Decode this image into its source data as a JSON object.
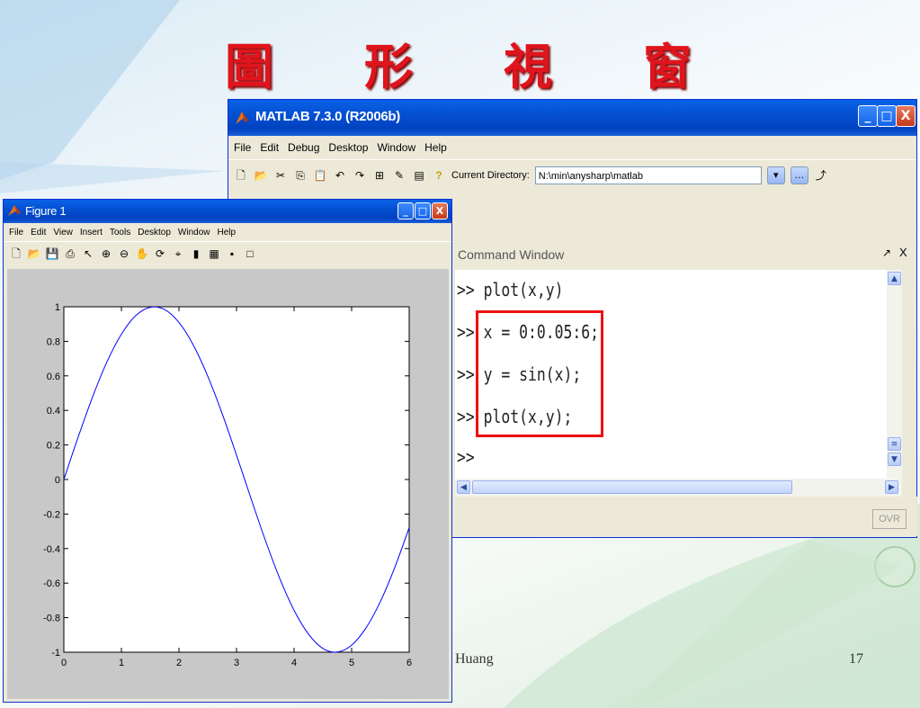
{
  "slide": {
    "title_chars": [
      "圖",
      "形",
      "視",
      "窗"
    ],
    "footer_text": "Huang",
    "page_number": "17"
  },
  "matlab": {
    "title": "MATLAB  7.3.0 (R2006b)",
    "menu": [
      "File",
      "Edit",
      "Debug",
      "Desktop",
      "Window",
      "Help"
    ],
    "current_directory_label": "Current Directory:",
    "current_directory_value": "N:\\min\\anysharp\\matlab",
    "command_window_title": "Command Window",
    "command_lines": [
      ">> plot(x,y)",
      ">> x = 0:0.05:6;",
      ">> y = sin(x);",
      ">> plot(x,y);",
      ">>"
    ],
    "status_ovr": "OVR",
    "window_buttons": {
      "minimize": "_",
      "maximize": "□",
      "close": "X"
    }
  },
  "figure": {
    "title": "Figure 1",
    "menu": [
      "File",
      "Edit",
      "View",
      "Insert",
      "Tools",
      "Desktop",
      "Window",
      "Help"
    ],
    "window_buttons": {
      "minimize": "_",
      "maximize": "□",
      "close": "X"
    }
  },
  "chart_data": {
    "type": "line",
    "title": "",
    "xlabel": "",
    "ylabel": "",
    "xlim": [
      0,
      6
    ],
    "ylim": [
      -1,
      1
    ],
    "xticks": [
      0,
      1,
      2,
      3,
      4,
      5,
      6
    ],
    "yticks": [
      -1,
      -0.8,
      -0.6,
      -0.4,
      -0.2,
      0,
      0.2,
      0.4,
      0.6,
      0.8,
      1
    ],
    "grid": false,
    "series": [
      {
        "color": "#0000ff",
        "x": [
          0,
          0.25,
          0.5,
          0.75,
          1,
          1.25,
          1.5,
          1.75,
          2,
          2.25,
          2.5,
          2.75,
          3,
          3.25,
          3.5,
          3.75,
          4,
          4.25,
          4.5,
          4.75,
          5,
          5.25,
          5.5,
          5.75,
          6
        ],
        "y": [
          0,
          0.247,
          0.479,
          0.682,
          0.841,
          0.949,
          0.997,
          0.984,
          0.909,
          0.778,
          0.598,
          0.382,
          0.141,
          -0.108,
          -0.351,
          -0.572,
          -0.757,
          -0.895,
          -0.978,
          -0.999,
          -0.959,
          -0.859,
          -0.706,
          -0.509,
          -0.279
        ]
      }
    ]
  }
}
